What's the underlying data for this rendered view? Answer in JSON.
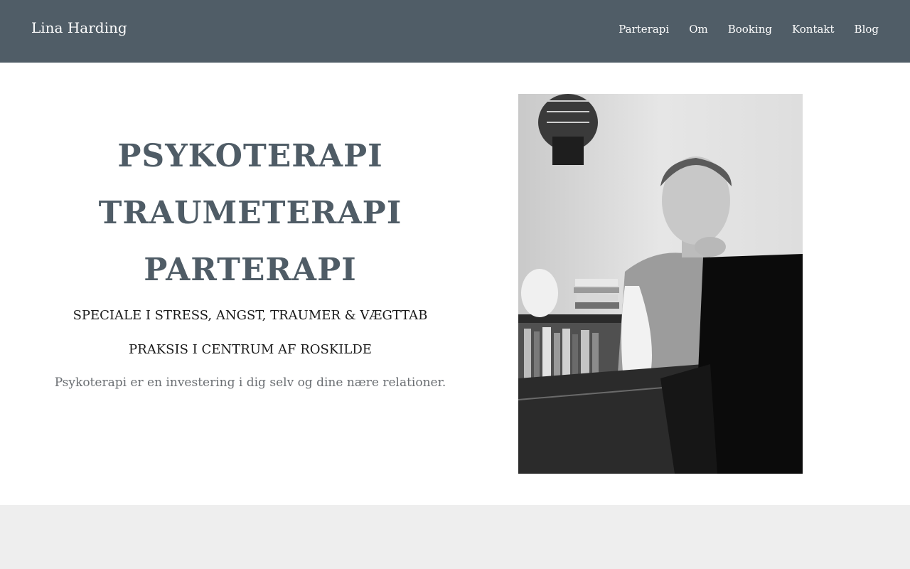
{
  "site": {
    "brand": "Lina Harding"
  },
  "nav": {
    "items": [
      {
        "label": "Parterapi"
      },
      {
        "label": "Om"
      },
      {
        "label": "Booking"
      },
      {
        "label": "Kontakt"
      },
      {
        "label": "Blog"
      }
    ]
  },
  "hero": {
    "titles": [
      "PSYKOTERAPI",
      "TRAUMETERAPI",
      "PARTERAPI"
    ],
    "subtitle1": "SPECIALE I STRESS, ANGST, TRAUMER & VÆGTTAB",
    "subtitle2": "PRAKSIS I CENTRUM AF ROSKILDE",
    "text": "Psykoterapi er en investering i dig selv og dine nære relationer."
  },
  "colors": {
    "header_bg": "#505d67",
    "title": "#4f5c66",
    "band_bg": "#eeeeee"
  }
}
